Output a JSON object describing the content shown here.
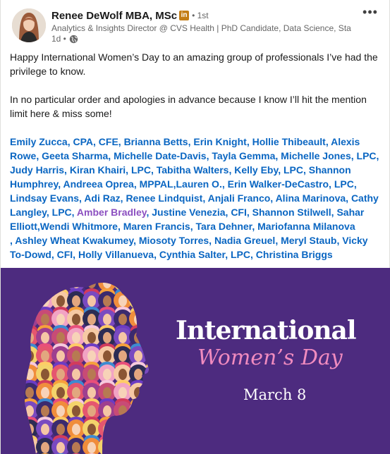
{
  "author": {
    "name": "Renee DeWolf MBA, MSc",
    "badge": "in",
    "degree": "• 1st",
    "headline": "Analytics & Insights Director @ CVS Health | PhD Candidate, Data Science, Sta...",
    "time": "1d •",
    "visibility_icon": "globe-icon"
  },
  "post": {
    "paragraphs": [
      "Happy International Women’s Day to an amazing group of professionals I’ve had the privilege to know.",
      "In no particular order and apologies in advance because I know I’ll hit the mention limit here & miss some!"
    ],
    "mentions": [
      {
        "text": "Emily Zucca, CPA, CFE",
        "sep": ", "
      },
      {
        "text": "Brianna Betts",
        "sep": ", "
      },
      {
        "text": "Erin Knight",
        "sep": ", "
      },
      {
        "text": "Hollie Thibeault",
        "sep": ", "
      },
      {
        "text": "Alexis Rowe",
        "sep": ", "
      },
      {
        "text": "Geeta Sharma",
        "sep": ", "
      },
      {
        "text": "Michelle Date-Davis",
        "sep": ", "
      },
      {
        "text": "Tayla Gemma",
        "sep": ", "
      },
      {
        "text": "Michelle Jones, LPC",
        "sep": ", "
      },
      {
        "text": "Judy Harris",
        "sep": ", "
      },
      {
        "text": "Kiran Khairi, LPC",
        "sep": ", "
      },
      {
        "text": "Tabitha Walters",
        "sep": ", "
      },
      {
        "text": "Kelly Eby, LPC",
        "sep": ", "
      },
      {
        "text": "Shannon Humphrey",
        "sep": ", "
      },
      {
        "text": "Andreea Oprea, MPPAL",
        "sep": ","
      },
      {
        "text": "Lauren O.",
        "sep": ", "
      },
      {
        "text": "Erin Walker-DeCastro, LPC",
        "sep": ", "
      },
      {
        "text": "Lindsay Evans",
        "sep": ", "
      },
      {
        "text": "Adi Raz",
        "sep": ", "
      },
      {
        "text": "Renee Lindquist",
        "sep": ", "
      },
      {
        "text": "Anjali Franco",
        "sep": ", "
      },
      {
        "text": "Alina Marinova",
        "sep": ", "
      },
      {
        "text": "Cathy Langley, LPC",
        "sep": ", "
      },
      {
        "text": "Amber Bradley",
        "sep": ", ",
        "visited": true
      },
      {
        "text": "Justine Venezia, CFI",
        "sep": ", "
      },
      {
        "text": "Shannon Stilwell",
        "sep": ", "
      },
      {
        "text": "Sahar Elliott",
        "sep": ","
      },
      {
        "text": "Wendi Whitmore",
        "sep": ", "
      },
      {
        "text": "Maren Francis",
        "sep": ", "
      },
      {
        "text": "Tara Dehner",
        "sep": ", "
      },
      {
        "text": "Mariofanna Milanova",
        "sep": "\n, ",
        "break": true
      },
      {
        "text": "Ashley Wheat Kwakumey",
        "sep": ", "
      },
      {
        "text": "Miosoty Torres",
        "sep": ", "
      },
      {
        "text": "Nadia Greuel",
        "sep": ", "
      },
      {
        "text": "Meryl Staub",
        "sep": ", "
      },
      {
        "text": "Vicky To-Dowd, CFI",
        "sep": ", "
      },
      {
        "text": "Holly Villanueva",
        "sep": ", "
      },
      {
        "text": "Cynthia Salter, LPC",
        "sep": ", "
      },
      {
        "text": "Christina Briggs",
        "sep": ""
      }
    ]
  },
  "image": {
    "title_line1": "International",
    "title_line2": "Women’s Day",
    "date": "March 8"
  },
  "colors": {
    "link": "#0a66c2",
    "visited_link": "#8b4fc0",
    "banner_bg": "#4d2b7f",
    "accent_pink": "#f08bbf"
  }
}
